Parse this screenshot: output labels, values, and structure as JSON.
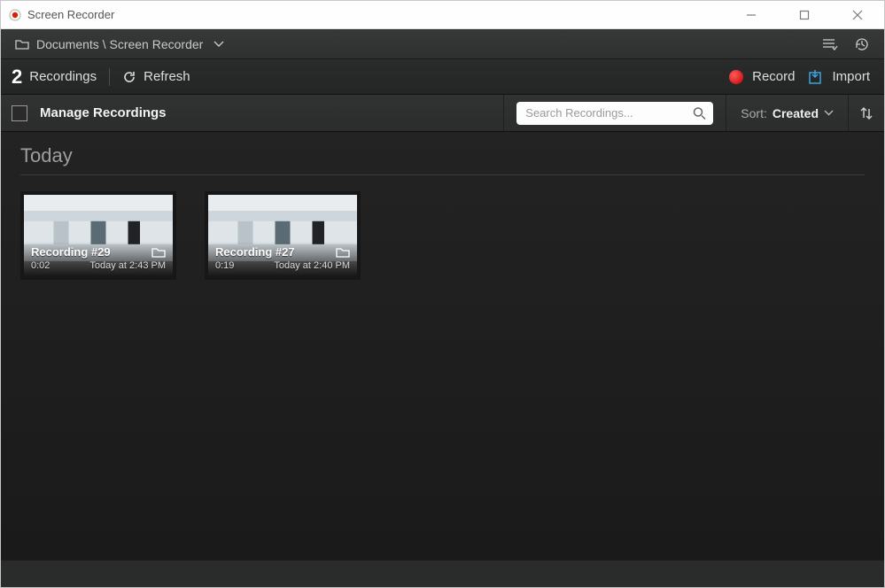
{
  "window": {
    "title": "Screen Recorder"
  },
  "breadcrumb": {
    "path": "Documents \\ Screen Recorder"
  },
  "toolbar": {
    "count": "2",
    "count_label": "Recordings",
    "refresh_label": "Refresh",
    "record_label": "Record",
    "import_label": "Import"
  },
  "manage": {
    "label": "Manage Recordings",
    "search_placeholder": "Search Recordings...",
    "sort_label": "Sort:",
    "sort_value": "Created"
  },
  "section": {
    "title": "Today"
  },
  "cards": [
    {
      "title": "Recording #29",
      "duration": "0:02",
      "time": "Today at 2:43 PM"
    },
    {
      "title": "Recording #27",
      "duration": "0:19",
      "time": "Today at 2:40 PM"
    }
  ]
}
